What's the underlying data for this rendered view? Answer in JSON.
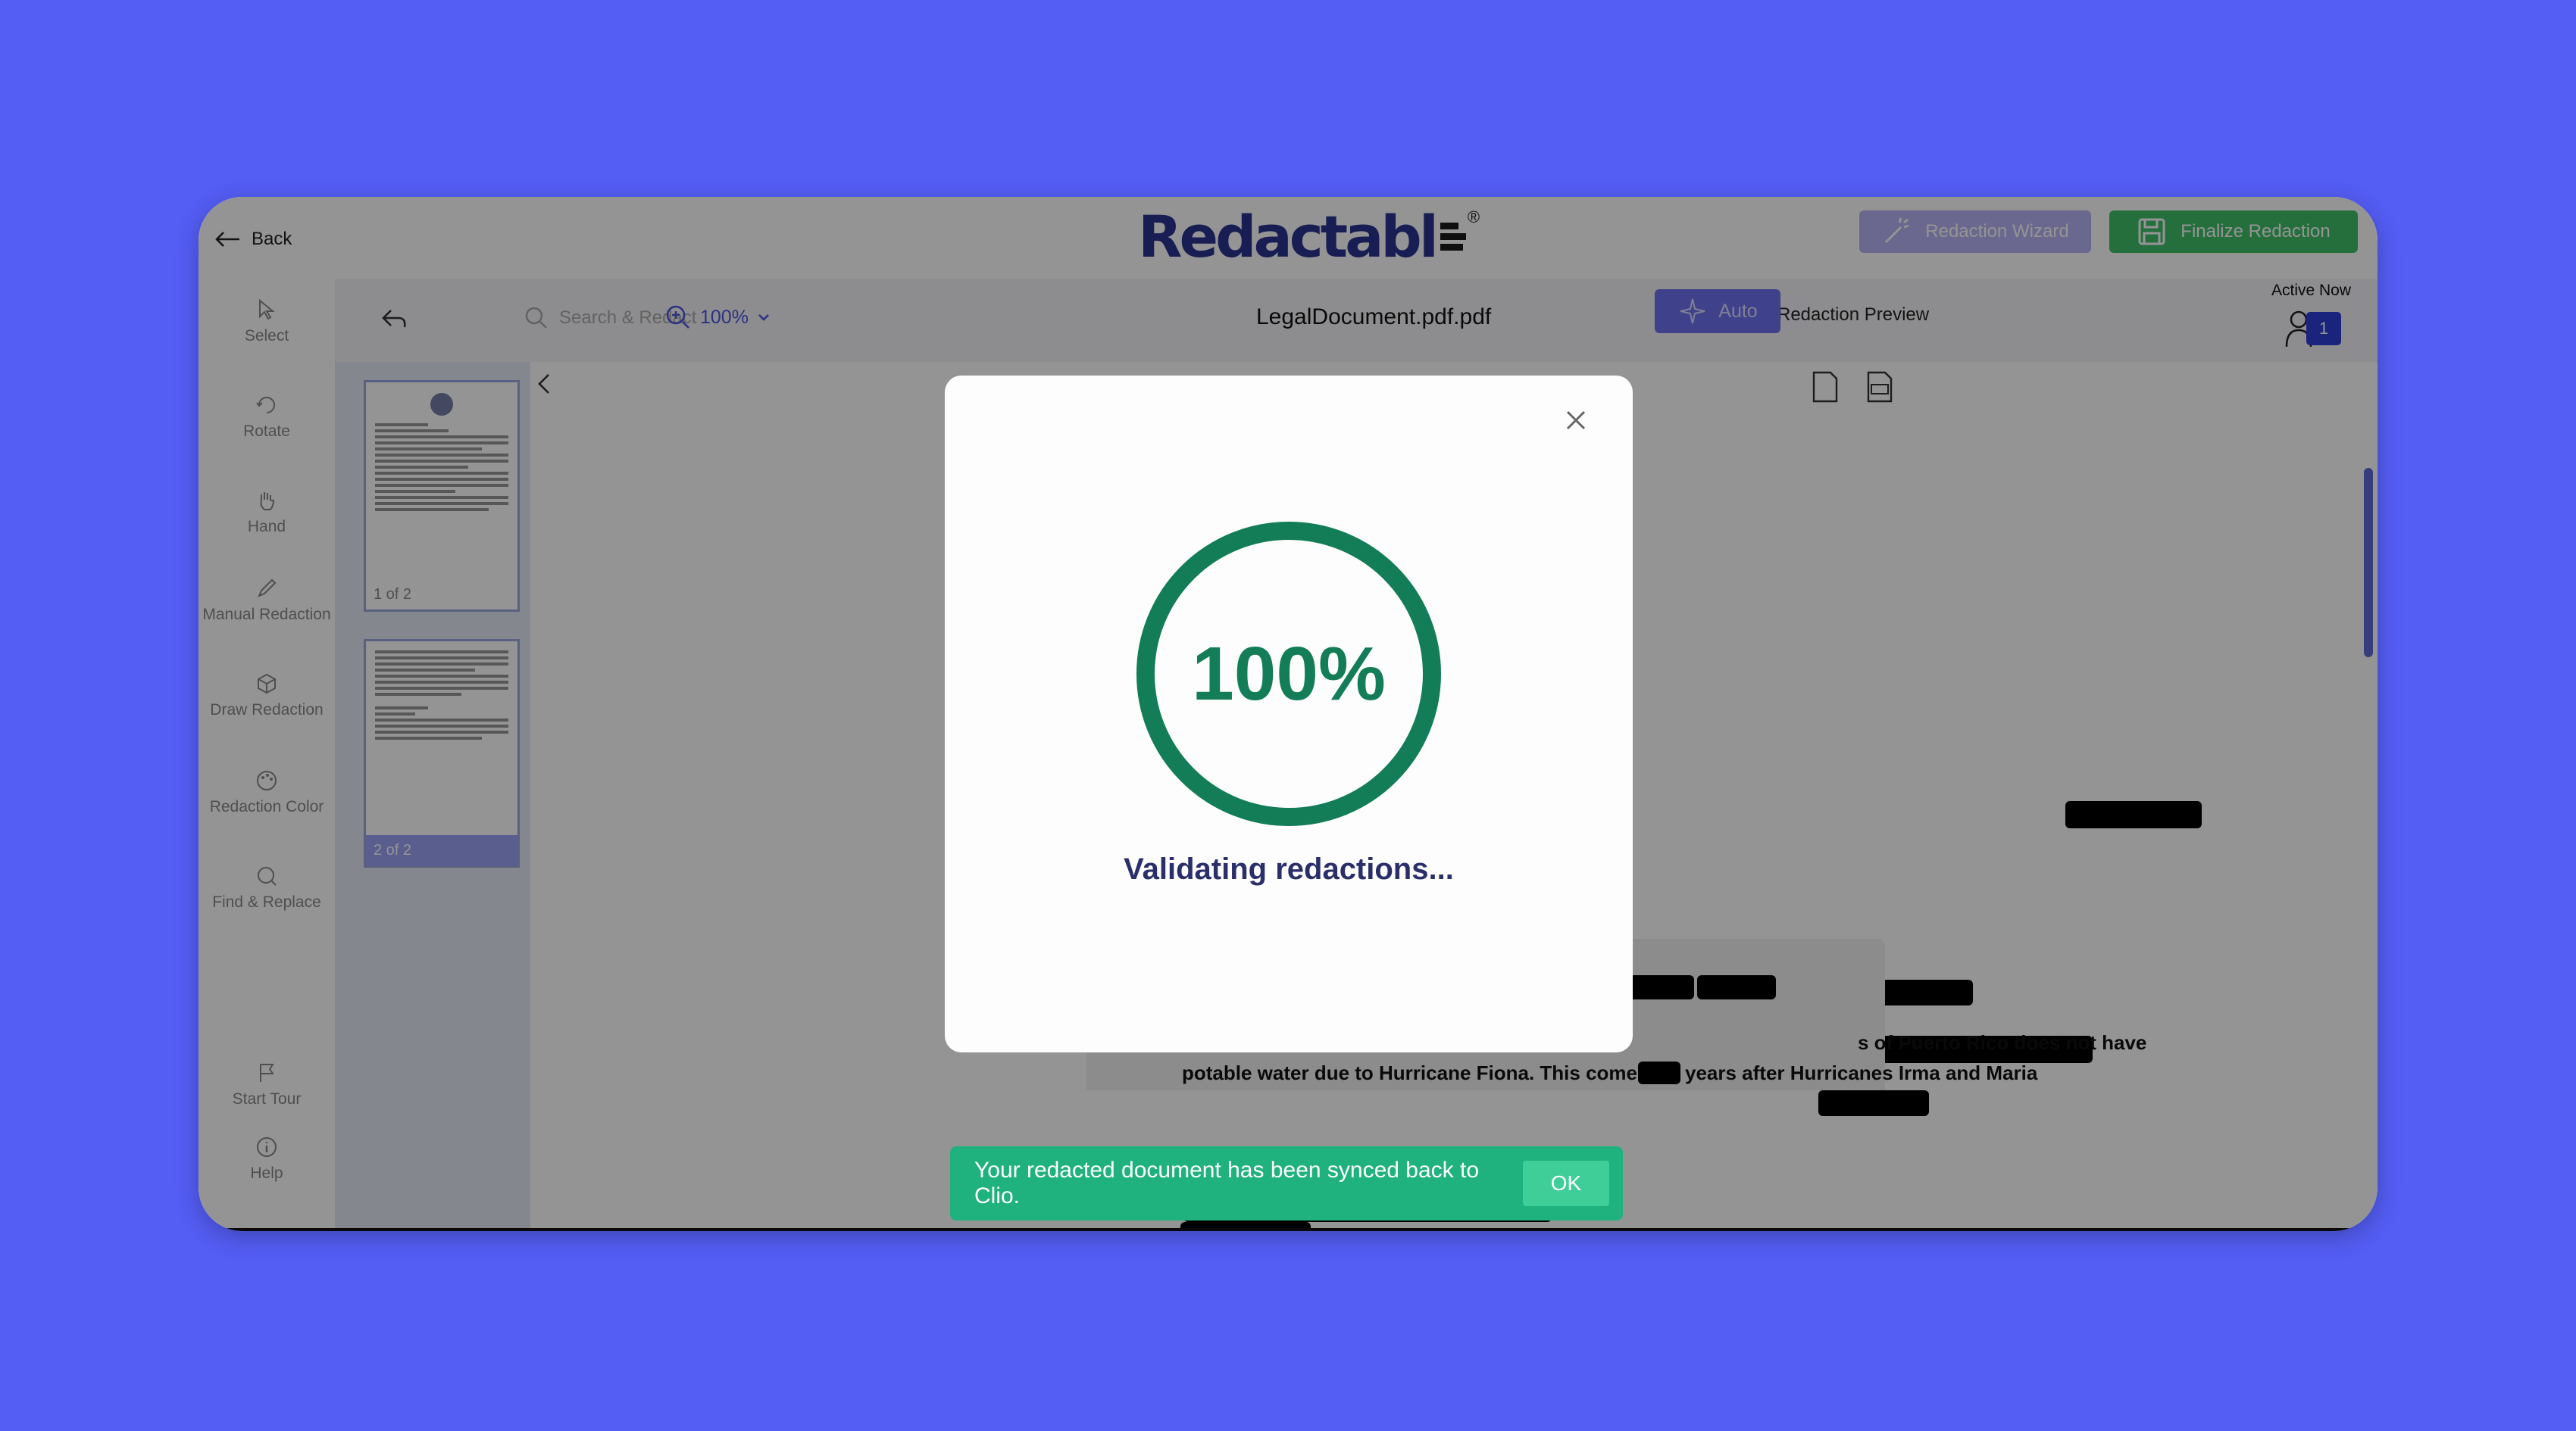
{
  "header": {
    "back_label": "Back",
    "logo_text": "Redactabl",
    "logo_reg": "®",
    "wizard_label": "Redaction Wizard",
    "finalize_label": "Finalize Redaction"
  },
  "tools": [
    {
      "label": "Select",
      "icon": "cursor-icon"
    },
    {
      "label": "Rotate",
      "icon": "rotate-icon"
    },
    {
      "label": "Hand",
      "icon": "hand-icon"
    },
    {
      "label": "Manual Redaction",
      "icon": "pen-icon"
    },
    {
      "label": "Draw Redaction",
      "icon": "shape-icon"
    },
    {
      "label": "Redaction Color",
      "icon": "palette-icon"
    },
    {
      "label": "Find & Replace",
      "icon": "find-replace-icon"
    },
    {
      "label": "Start Tour",
      "icon": "flag-icon"
    },
    {
      "label": "Help",
      "icon": "info-icon"
    }
  ],
  "toolbar": {
    "search_placeholder": "Search & Redact",
    "zoom": "100%",
    "filename": "LegalDocument.pdf.pdf",
    "preview_label": "Redaction Preview",
    "preview_on": true,
    "auto_label": "Auto",
    "active_now_label": "Active Now",
    "active_count": "1"
  },
  "thumbnails": [
    {
      "label": "1 of 2",
      "selected": true
    },
    {
      "label": "2 of 2",
      "selected": false
    }
  ],
  "document": {
    "line1": "s of Puerto Rico does not have",
    "line2": "potable water due to Hurricane Fiona.  This comes",
    "line2b": "years after Hurricanes Irma and Maria"
  },
  "modal": {
    "progress_text": "100%",
    "progress": 1.0,
    "status": "Validating redactions...",
    "ring_color": "#137d57"
  },
  "toast": {
    "message": "Your redacted document has been synced back to Clio.",
    "ok_label": "OK"
  }
}
